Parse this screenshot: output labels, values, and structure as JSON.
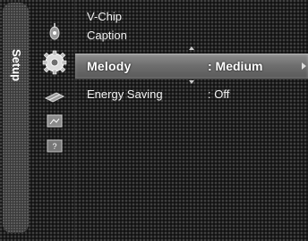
{
  "side_tab": {
    "label": "Setup"
  },
  "icons": [
    {
      "name": "broadcast-icon"
    },
    {
      "name": "setup-gear-icon",
      "active": true
    },
    {
      "name": "input-icon"
    },
    {
      "name": "application-icon"
    },
    {
      "name": "support-help-icon"
    }
  ],
  "menu": {
    "items": [
      {
        "label": "V-Chip",
        "value": ""
      },
      {
        "label": "Caption",
        "value": ""
      },
      {
        "label": "Melody",
        "value": ": Medium",
        "selected": true
      },
      {
        "label": "Energy Saving",
        "value": ": Off"
      }
    ]
  }
}
